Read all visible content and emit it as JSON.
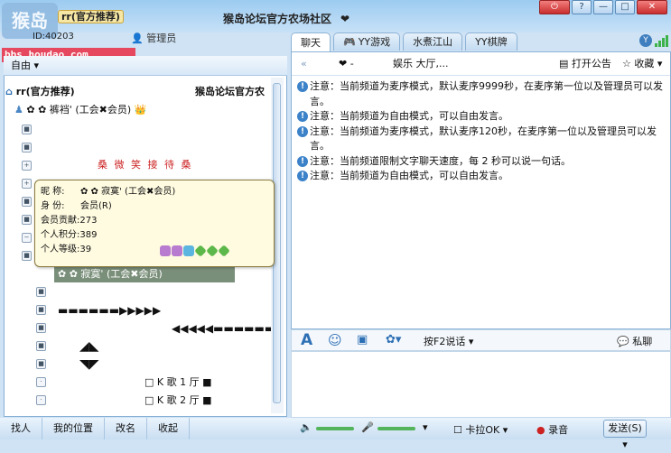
{
  "window": {
    "logo_text": "猴岛",
    "logo_url": "bbs.houdao.com",
    "channel_tag": "rr(官方推荐)",
    "user_id": "ID:40203",
    "user_role": "管理员",
    "room_title": "猴岛论坛官方农场社区",
    "heart": "❤",
    "buttons": {
      "power": "⏻",
      "help": "?",
      "min": "—",
      "max": "□",
      "close": "✕"
    }
  },
  "tabs": [
    {
      "label": "聊天",
      "icon": "",
      "active": true
    },
    {
      "label": "YY游戏",
      "icon": "🎮",
      "active": false
    },
    {
      "label": "水煮江山",
      "icon": "",
      "active": false
    },
    {
      "label": "YY棋牌",
      "icon": "",
      "active": false
    }
  ],
  "left": {
    "mode_label": "自由",
    "channel_name": "rr(官方推荐)",
    "channel_title_right": "猴岛论坛官方农",
    "user_row": {
      "name": "✿ ✿  裤裆'  (工会✖会员)",
      "crown": "👑",
      "heart": "❤"
    },
    "welcome": "桑  微 笑 接 待  桑",
    "selected_user": "✿  ✿   寂寞'   (工会✖会员)",
    "arrow_right": "▬▬▬▬▬▬▶▶▶▶▶",
    "arrow_left": "◀◀◀◀◀▬▬▬▬▬▬▬▬",
    "tri_up": "◢◣",
    "tri_down": "◥◤",
    "room1": "□  K  歌  1  厅  ■",
    "room2": "□  K  歌  2  厅  ■",
    "bottom_tabs": [
      "找人",
      "我的位置",
      "改名",
      "收起"
    ]
  },
  "popup": {
    "nickname_label": "昵  称:",
    "nickname": "✿  ✿   寂寞'   (工会✖会员)",
    "identity_label": "身  份:",
    "identity": "会员(R)",
    "contribution_label": "会员贡献:",
    "contribution": "273",
    "points_label": "个人积分:",
    "points": "389",
    "level_label": "个人等级:",
    "level": "39"
  },
  "chat": {
    "header_sym": "❤ -",
    "header_room": "娱乐 大厅,...",
    "announce": "打开公告",
    "favorite": "收藏",
    "messages": [
      "注意：当前频道为麦序模式，默认麦序9999秒，在麦序第一位以及管理员可以发言。",
      "注意：当前频道为自由模式，可以自由发言。",
      "注意：当前频道为麦序模式，默认麦序120秒，在麦序第一位以及管理员可以发言。",
      "注意：当前频道限制文字聊天速度，每 2 秒可以说一句话。",
      "注意：当前频道为自由模式，可以自由发言。"
    ]
  },
  "toolbar": {
    "f2": "按F2说话",
    "private": "私聊"
  },
  "status": {
    "karaoke": "卡拉OK",
    "record": "录音",
    "send": "发送(S)"
  },
  "colors": {
    "accent": "#3b82c9",
    "red": "#cc2222",
    "green": "#53b45b"
  }
}
